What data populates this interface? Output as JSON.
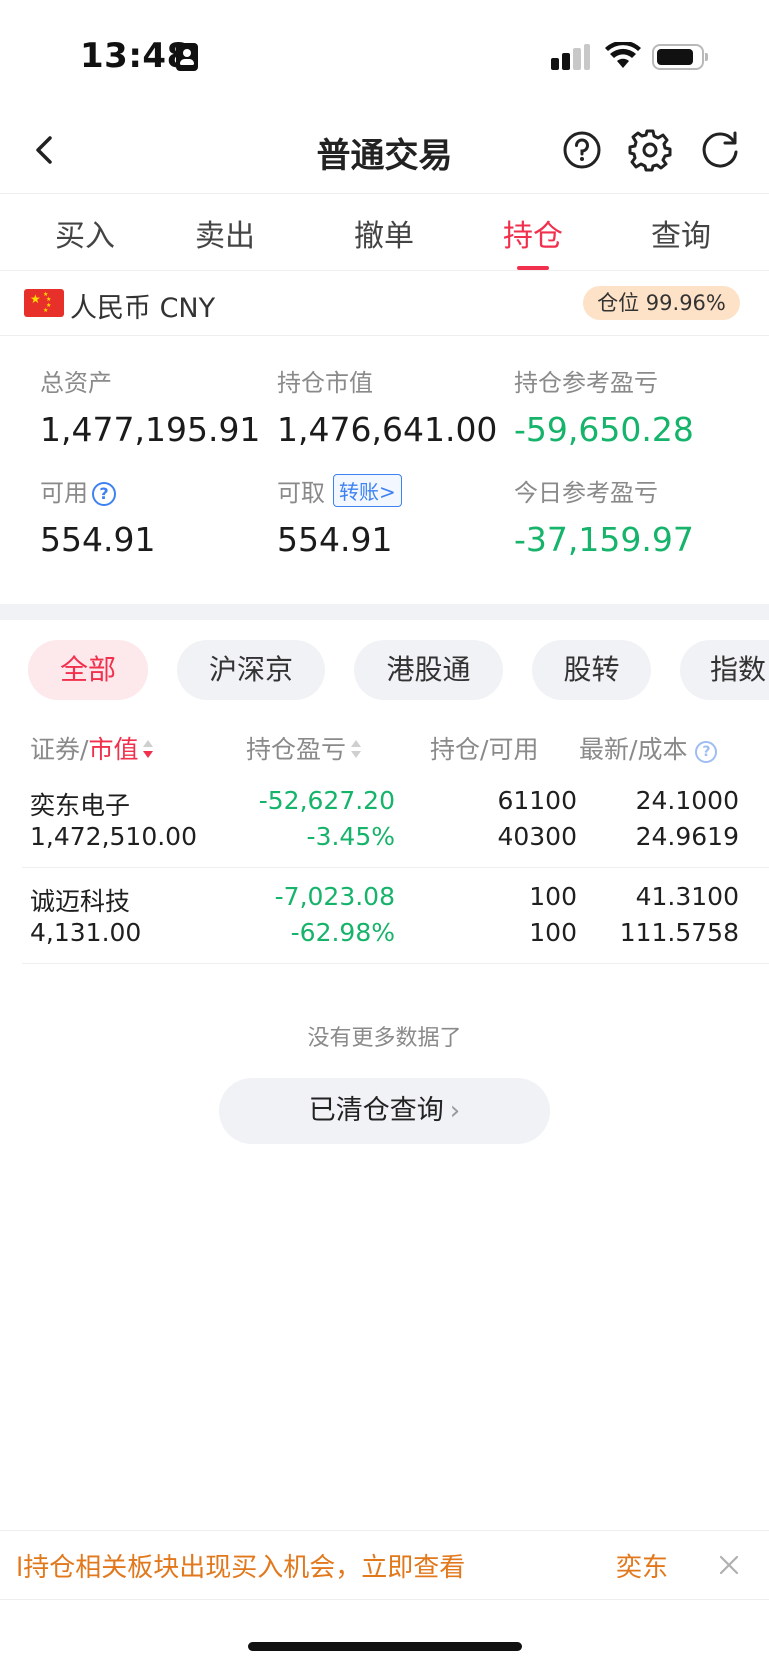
{
  "status_bar": {
    "time": "13:48"
  },
  "nav": {
    "title": "普通交易"
  },
  "tabs": [
    {
      "label": "买入",
      "active": false
    },
    {
      "label": "卖出",
      "active": false
    },
    {
      "label": "撤单",
      "active": false
    },
    {
      "label": "持仓",
      "active": true
    },
    {
      "label": "查询",
      "active": false
    }
  ],
  "currency": {
    "label": "人民币 CNY",
    "position_badge": "仓位 99.96%"
  },
  "summary": {
    "total_assets": {
      "label": "总资产",
      "value": "1,477,195.91"
    },
    "market_value": {
      "label": "持仓市值",
      "value": "1,476,641.00"
    },
    "position_pnl": {
      "label": "持仓参考盈亏",
      "value": "-59,650.28"
    },
    "available": {
      "label": "可用",
      "value": "554.91"
    },
    "withdrawable": {
      "label": "可取",
      "value": "554.91",
      "transfer_label": "转账>"
    },
    "today_pnl": {
      "label": "今日参考盈亏",
      "value": "-37,159.97"
    }
  },
  "filters": [
    {
      "label": "全部",
      "active": true
    },
    {
      "label": "沪深京",
      "active": false
    },
    {
      "label": "港股通",
      "active": false
    },
    {
      "label": "股转",
      "active": false
    },
    {
      "label": "指数",
      "active": false
    }
  ],
  "table": {
    "headers": {
      "security": "证券",
      "slash1": "/",
      "market_value": "市值",
      "pnl": "持仓盈亏",
      "holding": "持仓",
      "slash2": "/",
      "available": "可用",
      "latest": "最新",
      "slash3": "/",
      "cost": "成本"
    },
    "rows": [
      {
        "name": "奕东电子",
        "market_value": "1,472,510.00",
        "pnl": "-52,627.20",
        "pnl_pct": "-3.45%",
        "holding": "61100",
        "available": "40300",
        "latest": "24.1000",
        "cost": "24.9619"
      },
      {
        "name": "诚迈科技",
        "market_value": "4,131.00",
        "pnl": "-7,023.08",
        "pnl_pct": "-62.98%",
        "holding": "100",
        "available": "100",
        "latest": "41.3100",
        "cost": "111.5758"
      }
    ]
  },
  "footer": {
    "no_more": "没有更多数据了",
    "cleared_button": "已清仓查询",
    "chevron": "›"
  },
  "banner": {
    "text": "l持仓相关板块出现买入机会，立即查看",
    "stock": "奕东"
  },
  "colors": {
    "accent_red": "#f1304d",
    "loss_green": "#16b36a",
    "banner_orange": "#e2781c"
  }
}
